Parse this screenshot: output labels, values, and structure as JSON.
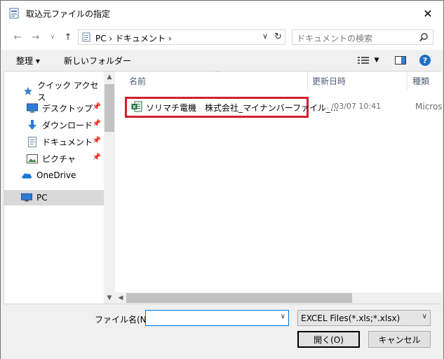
{
  "window": {
    "title": "取込元ファイルの指定",
    "close_glyph": "✕"
  },
  "address": {
    "path": "PC  ›  ドキュメント  ›",
    "dropdown_glyph": "∨",
    "refresh_glyph": "↻"
  },
  "search": {
    "placeholder": "ドキュメントの検索"
  },
  "toolbar": {
    "organize_label": "整理 ▾",
    "new_folder_label": "新しいフォルダー"
  },
  "nav": {
    "items": [
      {
        "label": "クイック アクセス",
        "icon": "star-icon"
      },
      {
        "label": "デスクトップ",
        "icon": "desktop-icon",
        "pinned": true
      },
      {
        "label": "ダウンロード",
        "icon": "download-icon",
        "pinned": true
      },
      {
        "label": "ドキュメント",
        "icon": "document-icon",
        "pinned": true
      },
      {
        "label": "ピクチャ",
        "icon": "picture-icon",
        "pinned": true
      },
      {
        "label": "OneDrive",
        "icon": "cloud-icon"
      },
      {
        "label": "PC",
        "icon": "pc-icon",
        "selected": true
      }
    ]
  },
  "columns": {
    "name": "名前",
    "modified": "更新日時",
    "type": "種類"
  },
  "files": [
    {
      "name": "ソリマチ電機　株式会社_マイナンバーファイル_...",
      "modified": "… /03/07 10:41",
      "type": "Microso",
      "icon": "excel-file-icon"
    }
  ],
  "bottom": {
    "filename_label": "ファイル名(N):",
    "filename_value": "",
    "filter_value": "EXCEL Files(*.xls;*.xlsx)",
    "open_label": "開く(O)",
    "cancel_label": "キャンセル"
  },
  "colors": {
    "highlight": "#d0202e",
    "accent": "#0078d7"
  }
}
